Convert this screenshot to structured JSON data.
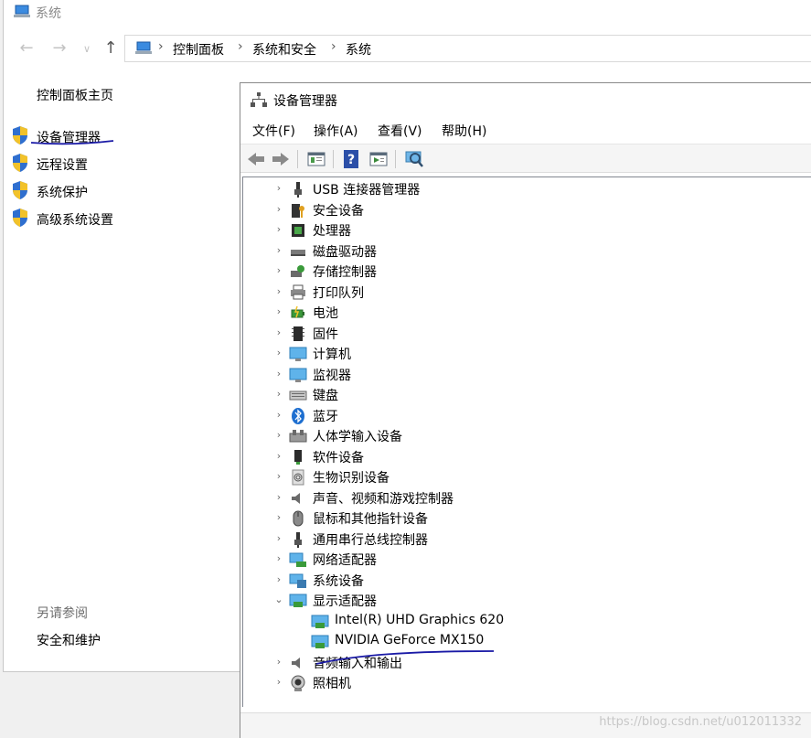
{
  "system_window": {
    "title": "系统",
    "breadcrumb": [
      "控制面板",
      "系统和安全",
      "系统"
    ],
    "sidebar": {
      "home": "控制面板主页",
      "links": [
        {
          "label": "设备管理器",
          "icon": "uac-shield-icon"
        },
        {
          "label": "远程设置",
          "icon": "uac-shield-icon"
        },
        {
          "label": "系统保护",
          "icon": "uac-shield-icon"
        },
        {
          "label": "高级系统设置",
          "icon": "uac-shield-icon"
        }
      ],
      "see_also_heading": "另请参阅",
      "see_also_links": [
        "安全和维护"
      ]
    }
  },
  "device_manager": {
    "title": "设备管理器",
    "menu": [
      "文件(F)",
      "操作(A)",
      "查看(V)",
      "帮助(H)"
    ],
    "toolbar": [
      "back-icon",
      "forward-icon",
      "properties-icon",
      "help-icon",
      "run-icon",
      "scan-hardware-icon"
    ],
    "tree": [
      {
        "label": "USB 连接器管理器",
        "icon": "usb-icon",
        "expanded": false
      },
      {
        "label": "安全设备",
        "icon": "security-key-icon",
        "expanded": false
      },
      {
        "label": "处理器",
        "icon": "processor-icon",
        "expanded": false
      },
      {
        "label": "磁盘驱动器",
        "icon": "disk-drive-icon",
        "expanded": false
      },
      {
        "label": "存储控制器",
        "icon": "storage-controller-icon",
        "expanded": false
      },
      {
        "label": "打印队列",
        "icon": "printer-icon",
        "expanded": false
      },
      {
        "label": "电池",
        "icon": "battery-icon",
        "expanded": false
      },
      {
        "label": "固件",
        "icon": "firmware-icon",
        "expanded": false
      },
      {
        "label": "计算机",
        "icon": "computer-icon",
        "expanded": false
      },
      {
        "label": "监视器",
        "icon": "monitor-icon",
        "expanded": false
      },
      {
        "label": "键盘",
        "icon": "keyboard-icon",
        "expanded": false
      },
      {
        "label": "蓝牙",
        "icon": "bluetooth-icon",
        "expanded": false
      },
      {
        "label": "人体学输入设备",
        "icon": "hid-icon",
        "expanded": false
      },
      {
        "label": "软件设备",
        "icon": "software-device-icon",
        "expanded": false
      },
      {
        "label": "生物识别设备",
        "icon": "fingerprint-icon",
        "expanded": false
      },
      {
        "label": "声音、视频和游戏控制器",
        "icon": "speaker-icon",
        "expanded": false
      },
      {
        "label": "鼠标和其他指针设备",
        "icon": "mouse-icon",
        "expanded": false
      },
      {
        "label": "通用串行总线控制器",
        "icon": "usb-icon",
        "expanded": false
      },
      {
        "label": "网络适配器",
        "icon": "network-adapter-icon",
        "expanded": false
      },
      {
        "label": "系统设备",
        "icon": "system-device-icon",
        "expanded": false
      },
      {
        "label": "显示适配器",
        "icon": "display-adapter-icon",
        "expanded": true,
        "children": [
          {
            "label": "Intel(R) UHD Graphics 620",
            "icon": "display-adapter-icon"
          },
          {
            "label": "NVIDIA GeForce MX150",
            "icon": "display-adapter-icon"
          }
        ]
      },
      {
        "label": "音频输入和输出",
        "icon": "speaker-icon",
        "expanded": false
      },
      {
        "label": "照相机",
        "icon": "camera-icon",
        "expanded": false
      }
    ]
  },
  "watermark": "https://blog.csdn.net/u012011332",
  "colors": {
    "annotation_ink": "#1a1aa6",
    "shield_blue": "#2f6fcf",
    "shield_yellow": "#f2c22a"
  }
}
